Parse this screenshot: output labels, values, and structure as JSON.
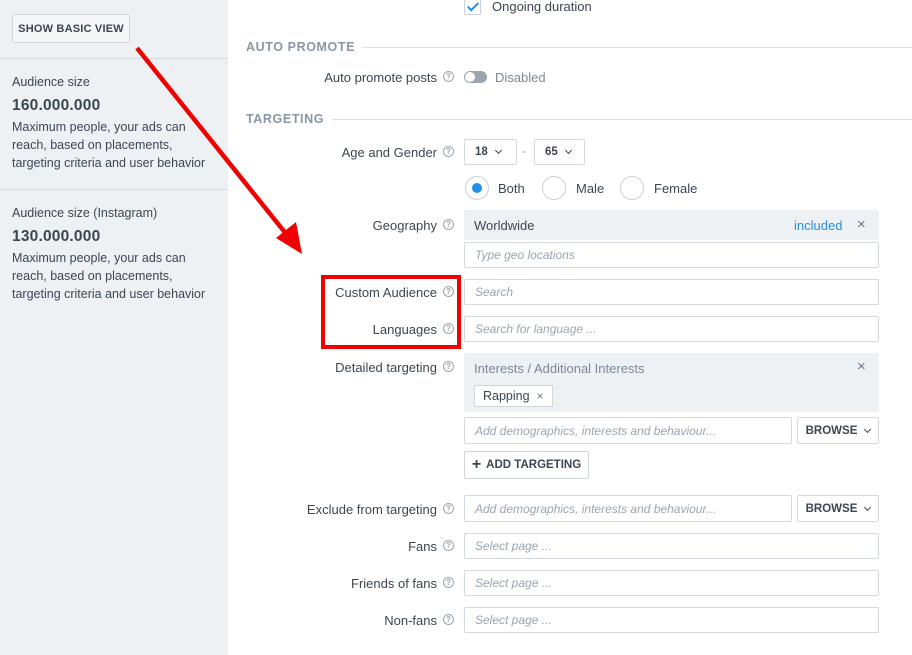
{
  "sidebar": {
    "basic_view_button": "SHOW BASIC VIEW",
    "audience": {
      "label": "Audience size",
      "value": "160.000.000",
      "description": "Maximum people, your ads can reach, based on placements, targeting criteria and user behavior"
    },
    "audience_instagram": {
      "label": "Audience size (Instagram)",
      "value": "130.000.000",
      "description": "Maximum people, your ads can reach, based on placements, targeting criteria and user behavior"
    }
  },
  "ongoing": {
    "label": "Ongoing duration",
    "checked": true
  },
  "auto_promote": {
    "section_title": "AUTO PROMOTE",
    "label": "Auto promote posts",
    "status": "Disabled",
    "enabled": false
  },
  "targeting": {
    "section_title": "TARGETING",
    "age_gender": {
      "label": "Age and Gender",
      "min_age": "18",
      "separator": "-",
      "max_age": "65",
      "options": [
        "Both",
        "Male",
        "Female"
      ],
      "selected": "Both"
    },
    "geography": {
      "label": "Geography",
      "selected_location": "Worldwide",
      "mode": "included",
      "placeholder": "Type geo locations"
    },
    "custom_audience": {
      "label": "Custom Audience",
      "placeholder": "Search"
    },
    "languages": {
      "label": "Languages",
      "placeholder": "Search for language ..."
    },
    "detailed": {
      "label": "Detailed targeting",
      "group_title": "Interests / Additional Interests",
      "tags": [
        "Rapping"
      ],
      "placeholder": "Add demographics, interests and behaviour...",
      "browse_label": "BROWSE",
      "add_label": "ADD TARGETING"
    },
    "exclude": {
      "label": "Exclude from targeting",
      "placeholder": "Add demographics, interests and behaviour...",
      "browse_label": "BROWSE"
    },
    "fans": {
      "label": "Fans",
      "placeholder": "Select page ..."
    },
    "friends_of_fans": {
      "label": "Friends of fans",
      "placeholder": "Select page ..."
    },
    "non_fans": {
      "label": "Non-fans",
      "placeholder": "Select page ..."
    }
  },
  "colors": {
    "accent": "#1e90e8",
    "annotation": "#f00000",
    "sidebar_bg": "#eef1f4"
  }
}
